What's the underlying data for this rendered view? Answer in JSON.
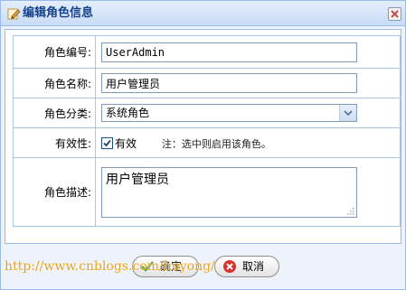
{
  "window": {
    "title": "编辑角色信息",
    "title_icon": "edit-icon",
    "close_icon": "close-icon"
  },
  "form": {
    "role_code": {
      "label": "角色编号:",
      "value": "UserAdmin"
    },
    "role_name": {
      "label": "角色名称:",
      "value": "用户管理员"
    },
    "role_category": {
      "label": "角色分类:",
      "selected": "系统角色"
    },
    "active": {
      "label": "有效性:",
      "checkbox_label": "有效",
      "checked": true,
      "note": "注：选中则启用该角色。"
    },
    "description": {
      "label": "角色描述:",
      "value": "用户管理员"
    }
  },
  "buttons": {
    "confirm": "确定",
    "cancel": "取消"
  },
  "watermark": "http://www.cnblogs.com/huyong/",
  "colors": {
    "border": "#99bbe8",
    "title_text": "#15428b",
    "watermark": "#e8a21c"
  }
}
